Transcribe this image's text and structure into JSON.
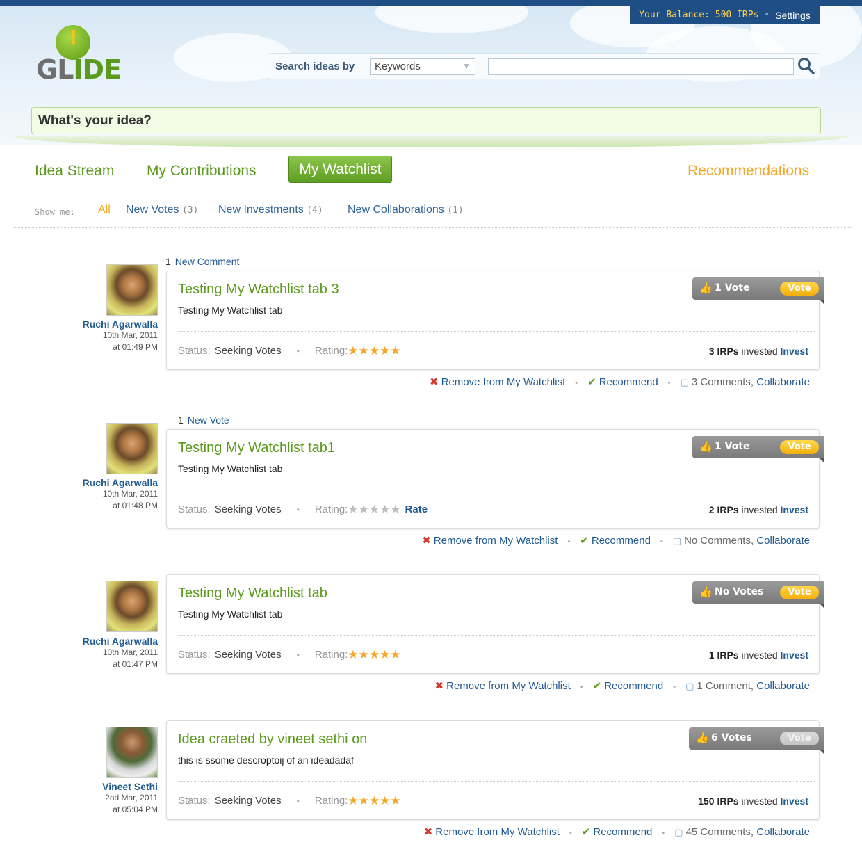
{
  "header": {
    "balance_text": "Your Balance: 500 IRPs",
    "settings_label": "Settings",
    "logo_text_gl": "GL",
    "logo_text_ide": "IDE",
    "logo_excl": "!",
    "search_label": "Search ideas by",
    "search_mode": "Keywords",
    "search_value": "",
    "idea_prompt": "What's your idea?"
  },
  "tabs": {
    "idea_stream": "Idea Stream",
    "my_contributions": "My Contributions",
    "my_watchlist": "My Watchlist",
    "recommendations": "Recommendations"
  },
  "filters": {
    "label": "Show me:",
    "all": "All",
    "new_votes": "New Votes",
    "new_votes_count": "(3)",
    "new_investments": "New Investments",
    "new_investments_count": "(4)",
    "new_collaborations": "New Collaborations",
    "new_collaborations_count": "(1)"
  },
  "items": [
    {
      "notice_num": "1",
      "notice_text": "New Comment",
      "author": "Ruchi Agarwalla",
      "date": "10th Mar, 2011",
      "time": "at 01:49 PM",
      "title": "Testing My Watchlist tab 3",
      "description": "Testing My Watchlist tab",
      "status_label": "Status:",
      "status_value": "Seeking Votes",
      "rating_label": "Rating:",
      "rating": 5,
      "stars": "★★★★★",
      "rate_link": "",
      "votes": "1 Vote",
      "vote_button": "Vote",
      "irps": "3 IRPs",
      "invested_text": "invested",
      "invest_link": "Invest",
      "remove_label": "Remove from My Watchlist",
      "recommend_label": "Recommend",
      "comments": "3 Comments,",
      "collaborate_label": "Collaborate"
    },
    {
      "notice_num": "1",
      "notice_text": "New Vote",
      "author": "Ruchi Agarwalla",
      "date": "10th Mar, 2011",
      "time": "at 01:48 PM",
      "title": "Testing My Watchlist tab1",
      "description": "Testing My Watchlist tab",
      "status_label": "Status:",
      "status_value": "Seeking Votes",
      "rating_label": "Rating:",
      "rating": 0,
      "stars": "★★★★★",
      "rate_link": "Rate",
      "votes": "1 Vote",
      "vote_button": "Vote",
      "irps": "2 IRPs",
      "invested_text": "invested",
      "invest_link": "Invest",
      "remove_label": "Remove from My Watchlist",
      "recommend_label": "Recommend",
      "comments": "No Comments,",
      "collaborate_label": "Collaborate"
    },
    {
      "author": "Ruchi Agarwalla",
      "date": "10th Mar, 2011",
      "time": "at 01:47 PM",
      "title": "Testing My Watchlist tab",
      "description": "Testing My Watchlist tab",
      "status_label": "Status:",
      "status_value": "Seeking Votes",
      "rating_label": "Rating:",
      "rating": 4.5,
      "stars": "★★★★★",
      "rate_link": "",
      "votes": "No Votes",
      "vote_button": "Vote",
      "irps": "1 IRPs",
      "invested_text": "invested",
      "invest_link": "Invest",
      "remove_label": "Remove from My Watchlist",
      "recommend_label": "Recommend",
      "comments": "1 Comment,",
      "collaborate_label": "Collaborate"
    },
    {
      "author": "Vineet Sethi",
      "date": "2nd Mar, 2011",
      "time": "at 05:04 PM",
      "title": "Idea craeted by vineet sethi on",
      "description": "this is ssome descroptoij of an ideadadaf",
      "status_label": "Status:",
      "status_value": "Seeking Votes",
      "rating_label": "Rating:",
      "rating": 4.5,
      "stars": "★★★★★",
      "rate_link": "",
      "votes": "6 Votes",
      "vote_button": "Vote",
      "irps": "150 IRPs",
      "invested_text": "invested",
      "invest_link": "Invest",
      "remove_label": "Remove from My Watchlist",
      "recommend_label": "Recommend",
      "comments": "45 Comments,",
      "collaborate_label": "Collaborate"
    }
  ],
  "icons": {
    "remove": "✖",
    "recommend": "✔",
    "comment": "▢",
    "thumb": "👍",
    "search": "search-icon",
    "dropdown": "▼",
    "dot": "•"
  },
  "colors": {
    "brand_blue": "#1f4e85",
    "green": "#5b9a1c",
    "orange": "#f5a623",
    "link_blue": "#1f5a93"
  }
}
